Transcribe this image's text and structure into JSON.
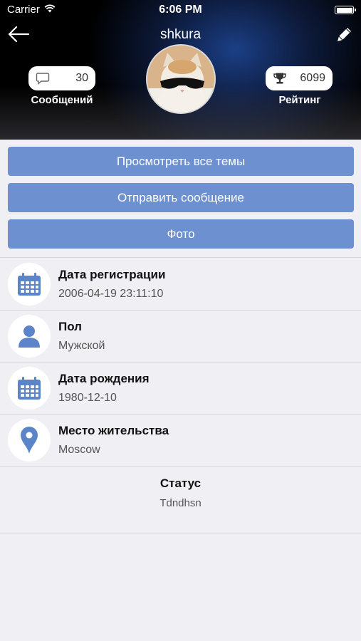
{
  "status_bar": {
    "carrier": "Carrier",
    "time": "6:06 PM"
  },
  "header": {
    "username": "shkura",
    "messages": {
      "count": "30",
      "label": "Сообщений",
      "icon": "speech-bubble-icon"
    },
    "rating": {
      "value": "6099",
      "label": "Рейтинг",
      "icon": "trophy-icon"
    }
  },
  "actions": {
    "view_topics": "Просмотреть все темы",
    "send_message": "Отправить сообщение",
    "photo": "Фото"
  },
  "info": {
    "registration": {
      "title": "Дата регистрации",
      "value": "2006-04-19 23:11:10",
      "icon": "calendar-icon"
    },
    "gender": {
      "title": "Пол",
      "value": "Мужской",
      "icon": "person-icon"
    },
    "birthday": {
      "title": "Дата рождения",
      "value": "1980-12-10",
      "icon": "calendar-icon"
    },
    "location": {
      "title": "Место жительства",
      "value": "Moscow",
      "icon": "location-pin-icon"
    }
  },
  "status": {
    "title": "Статус",
    "value": "Tdndhsn"
  },
  "colors": {
    "accent": "#6d91d0",
    "background": "#efeff4",
    "icon": "#5b84c9"
  }
}
